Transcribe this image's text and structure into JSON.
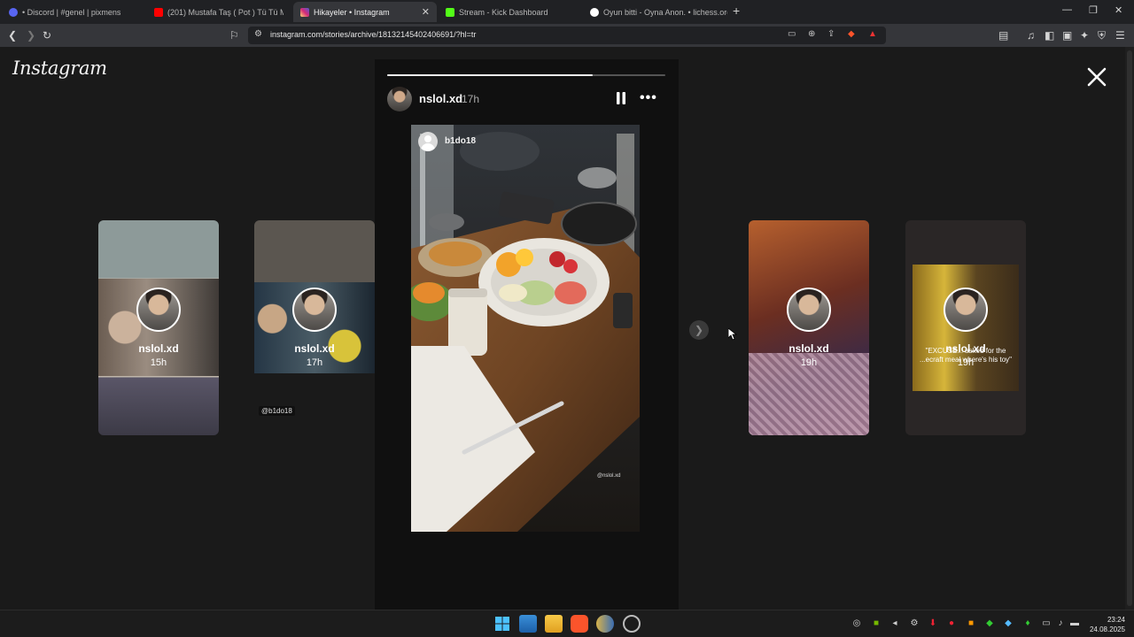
{
  "browser": {
    "tabs": [
      {
        "label": "• Discord | #genel | pixmens",
        "favicon_color": "#5865f2"
      },
      {
        "label": "(201) Mustafa Taş ( Pot ) Tü Tü M",
        "favicon_color": "#ff0000"
      },
      {
        "label": "Hikayeler • Instagram",
        "favicon_color": "#d62976"
      },
      {
        "label": "Stream - Kick Dashboard",
        "favicon_color": "#53fc18"
      },
      {
        "label": "Oyun bitti - Oyna Anon. • lichess.org",
        "favicon_color": "#ffffff"
      }
    ],
    "url": "instagram.com/stories/archive/18132145402406691/?hl=tr"
  },
  "page": {
    "logo": "Instagram",
    "left_previews": [
      {
        "user": "nslol.xd",
        "time": "15h",
        "tag": ""
      },
      {
        "user": "nslol.xd",
        "time": "17h",
        "tag": "@b1do18"
      }
    ],
    "right_previews": [
      {
        "user": "nslol.xd",
        "time": "19h",
        "caption": ""
      },
      {
        "user": "nslol.xd",
        "time": "19h",
        "caption": "\"EXCUSE... asked for the ...ecraft meal where's his toy\""
      }
    ],
    "story": {
      "user": "nslol.xd",
      "time": "17h",
      "progress": 0.74,
      "repost_user": "b1do18",
      "sticker_tag": "@nslol.xd"
    }
  },
  "taskbar": {
    "time": "23:24",
    "date": "24.08.2025"
  }
}
